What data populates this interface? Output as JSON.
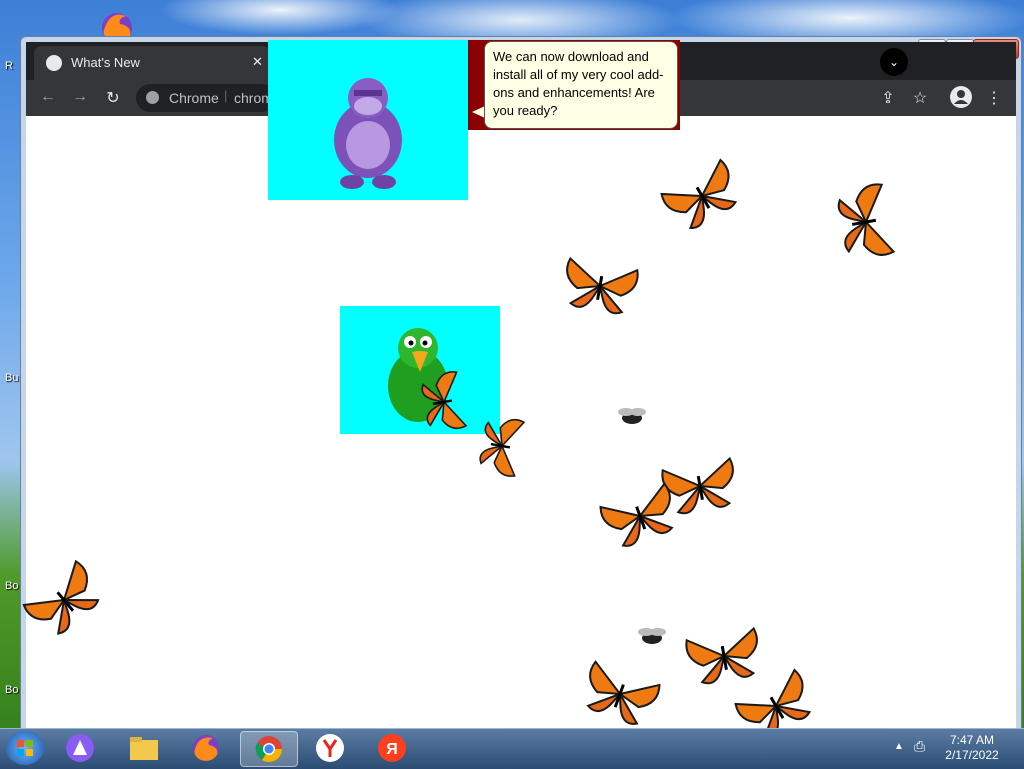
{
  "desktop": {
    "labels": [
      "R",
      "Bu",
      "Bo",
      "Bo"
    ]
  },
  "window": {
    "controls": {
      "minimize": "—",
      "restore": "▢",
      "close": "✕"
    }
  },
  "browser": {
    "tab_title": "What's New",
    "tab_close": "✕",
    "omnibox_label": "Chrome",
    "omnibox_url": "chrom",
    "nav": {
      "back": "←",
      "forward": "→",
      "reload": "↻"
    }
  },
  "bonzi": {
    "speech": "We can now download and install all of my very cool add-ons and enhancements! Are you ready?"
  },
  "taskbar": {
    "time": "7:47 AM",
    "date": "2/17/2022"
  },
  "colors": {
    "agent_bg": "#00ffff",
    "chrome_dark": "#35363a",
    "butterfly": "#f07a12"
  }
}
